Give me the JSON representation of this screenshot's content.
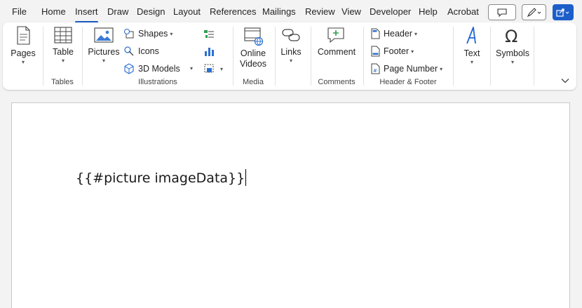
{
  "menu": {
    "tabs": [
      "File",
      "Home",
      "Insert",
      "Draw",
      "Design",
      "Layout",
      "References",
      "Mailings",
      "Review",
      "View",
      "Developer",
      "Help",
      "Acrobat"
    ],
    "active_tab": "Insert"
  },
  "ribbon": {
    "pages": {
      "label": "Pages"
    },
    "tables": {
      "table_label": "Table",
      "group": "Tables"
    },
    "illustrations": {
      "pictures_label": "Pictures",
      "shapes_label": "Shapes",
      "icons_label": "Icons",
      "models_label": "3D Models",
      "group": "Illustrations"
    },
    "media": {
      "online_videos_line1": "Online",
      "online_videos_line2": "Videos",
      "group": "Media"
    },
    "links": {
      "label": "Links"
    },
    "comments": {
      "comment_label": "Comment",
      "group": "Comments"
    },
    "header_footer": {
      "header_label": "Header",
      "footer_label": "Footer",
      "page_number_label": "Page Number",
      "group": "Header & Footer"
    },
    "text": {
      "label": "Text"
    },
    "symbols": {
      "label": "Symbols"
    }
  },
  "document": {
    "body_text": "{{#picture imageData}}"
  },
  "colors": {
    "accent": "#185abd",
    "share_button": "#1c5ec9",
    "text_icon": "#2266d3"
  }
}
